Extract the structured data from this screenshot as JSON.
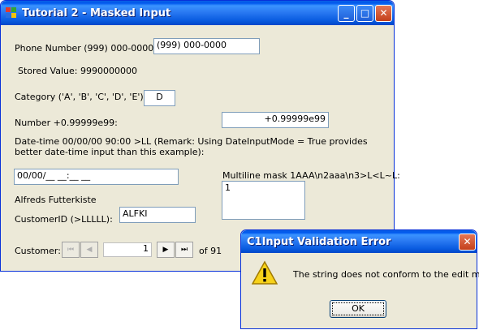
{
  "main_window": {
    "title": "Tutorial 2 - Masked Input",
    "minimize": "_",
    "maximize": "□",
    "close": "✕",
    "phone": {
      "label": "Phone Number (999) 000-0000:",
      "value": "(999) 000-0000"
    },
    "stored_value": "Stored Value: 9990000000",
    "category": {
      "label": "Category ('A', 'B', 'C', 'D', 'E'):",
      "value": "D"
    },
    "number": {
      "label": "Number +0.99999e99:",
      "value": "+0.99999e99"
    },
    "datetime": {
      "label": "Date-time 00/00/00 90:00 >LL (Remark: Using DateInputMode = True provides better date-time input than this example):",
      "value": "00/00/__ __:__ __"
    },
    "multiline": {
      "label": "Multiline mask 1AAA\\n2aaa\\n3>L<L~L:",
      "value": "1"
    },
    "company_name": "Alfreds Futterkiste",
    "customer_id": {
      "label": "CustomerID (>LLLLL):",
      "value": "ALFKI"
    },
    "navigator": {
      "label": "Customer:",
      "first": "⏮",
      "prev": "◀",
      "position": "1",
      "next": "▶",
      "last": "⏭",
      "total": "of 91"
    }
  },
  "dialog": {
    "title": "C1Input Validation Error",
    "close": "✕",
    "message": "The string does not conform to the edit mask.",
    "ok_label": "OK"
  }
}
